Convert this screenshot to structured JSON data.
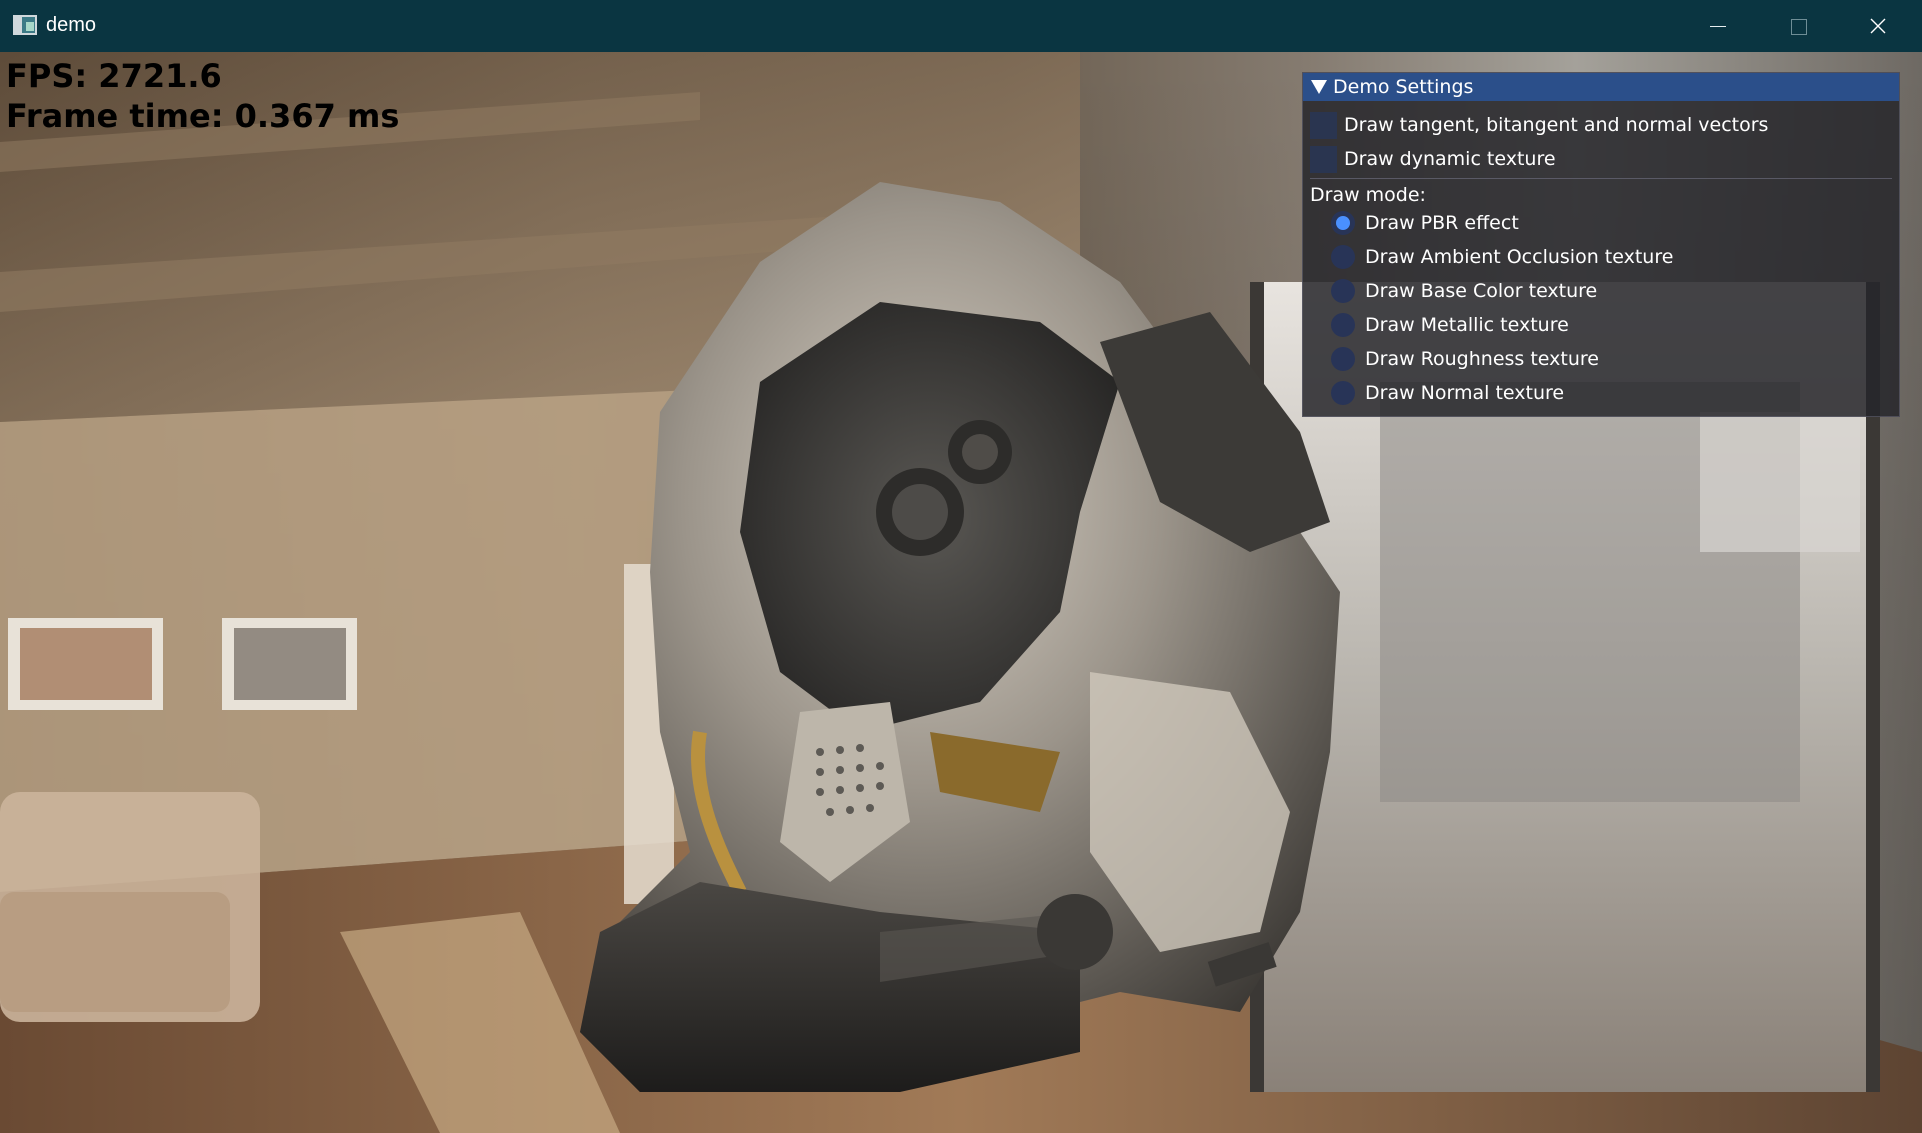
{
  "window": {
    "title": "demo",
    "icons": {
      "app": "app-icon",
      "minimize": "minimize-icon",
      "maximize": "maximize-icon",
      "close": "close-icon"
    }
  },
  "stats": {
    "fps": "FPS: 2721.6",
    "frame_time": "Frame time: 0.367 ms"
  },
  "settings": {
    "title": "Demo Settings",
    "checkboxes": [
      {
        "label": "Draw tangent, bitangent and normal vectors",
        "checked": false
      },
      {
        "label": "Draw dynamic texture",
        "checked": false
      }
    ],
    "draw_mode_label": "Draw mode:",
    "draw_modes": [
      {
        "label": "Draw PBR effect",
        "selected": true
      },
      {
        "label": "Draw Ambient Occlusion texture",
        "selected": false
      },
      {
        "label": "Draw Base Color texture",
        "selected": false
      },
      {
        "label": "Draw Metallic texture",
        "selected": false
      },
      {
        "label": "Draw Roughness texture",
        "selected": false
      },
      {
        "label": "Draw Normal texture",
        "selected": false
      }
    ]
  },
  "colors": {
    "titlebar": "#0a3541",
    "panel_header": "#2b4f8a",
    "radio_selected": "#4a90ff"
  }
}
